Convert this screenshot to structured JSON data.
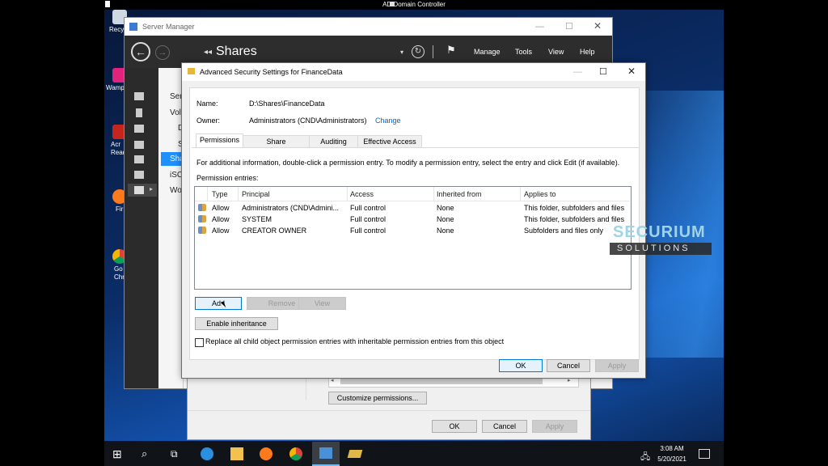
{
  "vm": {
    "title": "AD Domain Controller"
  },
  "desktop": {
    "icons": [
      {
        "label": "Recy"
      },
      {
        "label": "Wamp"
      },
      {
        "label": "Acr\nRead"
      },
      {
        "label": "Fir"
      },
      {
        "label": "Go\nChr"
      }
    ]
  },
  "server_manager": {
    "title": "Server Manager",
    "breadcrumb": "Shares",
    "menu": [
      "Manage",
      "Tools",
      "View",
      "Help"
    ],
    "nav_items": [
      "Ser",
      "Vol",
      "D",
      "S",
      "Sha",
      "iSC",
      "Wo"
    ]
  },
  "share_props": {
    "customize_label": "Customize permissions...",
    "ok": "OK",
    "cancel": "Cancel",
    "apply": "Apply"
  },
  "advanced": {
    "title": "Advanced Security Settings for FinanceData",
    "name_label": "Name:",
    "name_value": "D:\\Shares\\FinanceData",
    "owner_label": "Owner:",
    "owner_value": "Administrators (CND\\Administrators)",
    "change_link": "Change",
    "tabs": [
      "Permissions",
      "Share",
      "Auditing",
      "Effective Access"
    ],
    "info_text": "For additional information, double-click a permission entry. To modify a permission entry, select the entry and click Edit (if available).",
    "entries_label": "Permission entries:",
    "columns": [
      "Type",
      "Principal",
      "Access",
      "Inherited from",
      "Applies to"
    ],
    "rows": [
      {
        "type": "Allow",
        "principal": "Administrators (CND\\Admini...",
        "access": "Full control",
        "inherited": "None",
        "applies": "This folder, subfolders and files"
      },
      {
        "type": "Allow",
        "principal": "SYSTEM",
        "access": "Full control",
        "inherited": "None",
        "applies": "This folder, subfolders and files"
      },
      {
        "type": "Allow",
        "principal": "CREATOR OWNER",
        "access": "Full control",
        "inherited": "None",
        "applies": "Subfolders and files only"
      }
    ],
    "add": "Add",
    "remove": "Remove",
    "view": "View",
    "enable_inheritance": "Enable inheritance",
    "replace_label": "Replace all child object permission entries with inheritable permission entries from this object",
    "ok": "OK",
    "cancel": "Cancel",
    "apply": "Apply"
  },
  "watermark": {
    "line1": "SECURIUM",
    "line2": "SOLUTIONS"
  },
  "taskbar": {
    "time": "3:08 AM",
    "date": "5/20/2021"
  },
  "colors": {
    "accent": "#0078d7",
    "link": "#0066cc"
  }
}
